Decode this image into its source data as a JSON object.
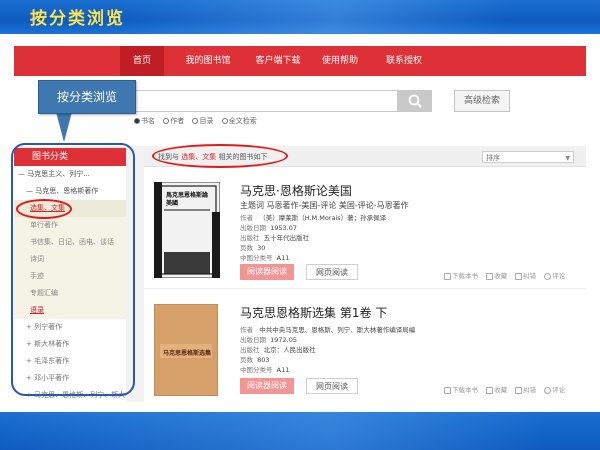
{
  "slide": {
    "title": "按分类浏览"
  },
  "nav": {
    "items": [
      "首页",
      "我的图书馆",
      "客户端下载",
      "使用帮助",
      "联系授权"
    ],
    "active_index": 0
  },
  "search": {
    "placeholder": "",
    "advanced_label": "高级检索",
    "scope_options": [
      "书名",
      "作者",
      "目录",
      "全文检索"
    ],
    "scope_selected": 0
  },
  "sidebar": {
    "title": "图书分类",
    "items": [
      {
        "prefix": "—",
        "label": "马克思主义、列宁..."
      },
      {
        "prefix": "—",
        "label": "马克思、恩格斯著作"
      },
      {
        "prefix": "",
        "label": "选集、文集"
      },
      {
        "prefix": "",
        "label": "单行著作"
      },
      {
        "prefix": "",
        "label": "书信集、日记、函电、谈话"
      },
      {
        "prefix": "",
        "label": "诗词"
      },
      {
        "prefix": "",
        "label": "手迹"
      },
      {
        "prefix": "",
        "label": "专题汇编"
      },
      {
        "prefix": "",
        "label": "语录"
      },
      {
        "prefix": "+",
        "label": "列宁著作"
      },
      {
        "prefix": "+",
        "label": "斯大林著作"
      },
      {
        "prefix": "+",
        "label": "毛泽东著作"
      },
      {
        "prefix": "+",
        "label": "邓小平著作"
      },
      {
        "prefix": "+",
        "label": "马克思、恩格斯、列宁、斯大林..."
      }
    ]
  },
  "results": {
    "summary_prefix": "找到与",
    "summary_keyword": "选集、文集",
    "summary_suffix": "相关的图书如下",
    "sort_label": "排序"
  },
  "meta_labels": {
    "author": "作者",
    "date": "出版日期",
    "publisher": "出版社",
    "pages": "页数",
    "clc": "中图分类号"
  },
  "books": [
    {
      "title": "马克思·恩格斯论美国",
      "subject": "主题词 马恩著作-美国-评论 美国-评论-马恩著作",
      "author": "（美）摩莱斯（H.M.Morais）著；孙承佩译",
      "date": "1953.07",
      "publisher": "五十年代出版社",
      "pages": "30",
      "clc": "A11",
      "cover_text": "馬克思恩格斯論美國",
      "cover_colors": {
        "bg": "#f2f2f2",
        "ink": "#111111"
      },
      "btn_app": "阅读器阅读",
      "btn_web": "网页阅读",
      "actions": [
        "下载本书",
        "收藏",
        "纠错",
        "评论"
      ]
    },
    {
      "title": "马克思恩格斯选集 第1卷 下",
      "subject": "",
      "author": "中共中央马克思、恩格斯、列宁、斯大林著作编译局编",
      "date": "1972.05",
      "publisher": "北京：人民出版社",
      "pages": "803",
      "clc": "A11",
      "cover_text": "马克思恩格斯选集",
      "cover_colors": {
        "bg": "#d6a06a",
        "ink": "#5a2a10"
      },
      "btn_app": "阅读器阅读",
      "btn_web": "网页阅读",
      "actions": [
        "下载本书",
        "收藏",
        "纠错",
        "评论"
      ]
    }
  ],
  "callout": {
    "text": "按分类浏览"
  },
  "colors": {
    "nav_red": "#de3037",
    "highlight_red": "#d9232a",
    "annotation_red": "#e01b1b",
    "annotation_blue": "#2a56b4",
    "title_yellow": "#ffe34d"
  }
}
